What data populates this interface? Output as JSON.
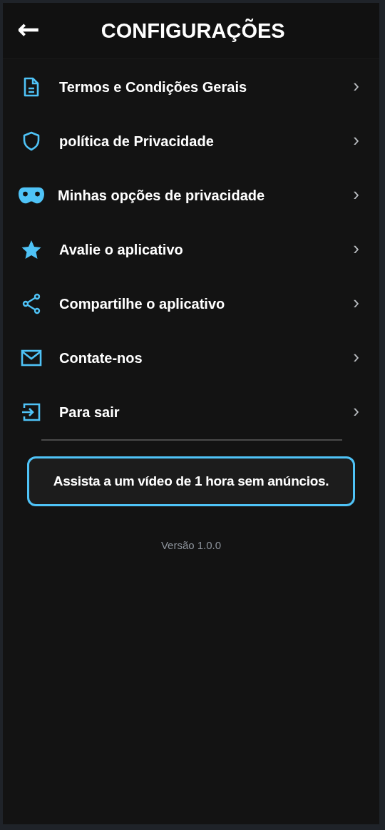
{
  "header": {
    "back_icon": "←",
    "title": "CONFIGURAÇÕES"
  },
  "items": [
    {
      "kind": "document",
      "label": "Termos e Condições Gerais",
      "chevron": "›"
    },
    {
      "kind": "shield",
      "label": "política de Privacidade",
      "chevron": "›"
    },
    {
      "kind": "mask",
      "label": "Minhas opções de privacidade",
      "chevron": "›"
    },
    {
      "kind": "star",
      "label": "Avalie o aplicativo",
      "chevron": "›"
    },
    {
      "kind": "share",
      "label": "Compartilhe o aplicativo",
      "chevron": "›"
    },
    {
      "kind": "mail",
      "label": "Contate-nos",
      "chevron": "›"
    },
    {
      "kind": "exit",
      "label": "Para sair",
      "chevron": "›"
    }
  ],
  "ad_button": {
    "label": "Assista a um vídeo de 1 hora sem anúncios."
  },
  "version": "Versão 1.0.0"
}
